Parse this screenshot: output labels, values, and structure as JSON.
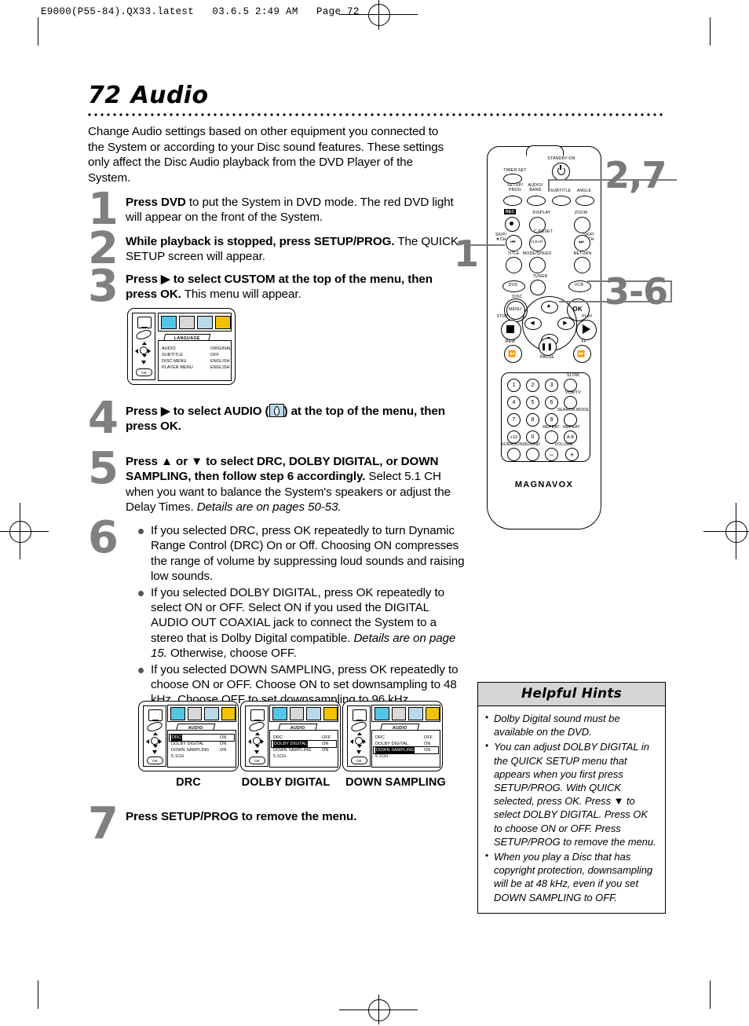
{
  "header": {
    "slug": "E9000(P55-84).QX33.latest   03.6.5 2:49 AM   Page 72"
  },
  "page": {
    "number": "72",
    "title": "Audio",
    "intro": "Change Audio settings based on other equipment you connected to the System or according to your Disc sound features. These settings only affect the Disc Audio playback from the DVD Player of the System."
  },
  "steps": [
    {
      "num": "1",
      "html": "<b>Press DVD</b> to put the System in DVD mode. The red DVD light will appear on the front of the System."
    },
    {
      "num": "2",
      "html": "<b>While playback is stopped, press SETUP/PROG.</b> The QUICK SETUP screen will appear."
    },
    {
      "num": "3",
      "html": "<b>Press ▶ to select CUSTOM at the top of the menu, then press OK.</b>  This menu will appear."
    },
    {
      "num": "4",
      "html": "<b>Press ▶ to select AUDIO (</b><span class=\"inline-audio\" data-name=\"audio-icon\"></span><b>) at the top of the menu, then press OK.</b>"
    },
    {
      "num": "5",
      "html": "<b>Press ▲ or ▼ to select DRC, DOLBY DIGITAL, or DOWN SAMPLING, then follow step 6 accordingly.</b> Select 5.1 CH when you want to balance the System's speakers or adjust the Delay Times. <i>Details are on pages 50-53.</i>"
    },
    {
      "num": "6",
      "bullets": [
        "If you selected DRC, press OK repeatedly to turn Dynamic Range Control (DRC) On or Off. Choosing ON compresses the range of volume by suppressing loud sounds and raising low sounds.",
        "If you selected DOLBY DIGITAL, press OK repeatedly to select ON or OFF. Select ON if you used the DIGITAL AUDIO OUT COAXIAL jack to connect the System to a stereo that is Dolby Digital compatible. <i>Details are on page 15.</i> Otherwise, choose OFF.",
        "If you selected DOWN SAMPLING, press OK repeatedly to choose ON or OFF. Choose ON to set downsampling to 48 kHz. Choose OFF to set downsampling to 96 kHz."
      ]
    },
    {
      "num": "7",
      "html": "<b>Press SETUP/PROG to remove the menu.</b>"
    }
  ],
  "osd_language": {
    "tab": "LANGUAGE",
    "rows": [
      {
        "label": "AUDIO",
        "value": "ORIGINAL",
        "highlight": false
      },
      {
        "label": "SUBTITLE",
        "value": "OFF",
        "highlight": false
      },
      {
        "label": "DISC MENU",
        "value": "ENGLISH",
        "highlight": false
      },
      {
        "label": "PLAYER MENU",
        "value": "ENGLISH",
        "highlight": false
      }
    ],
    "ok_label": "OK"
  },
  "osd_audio_screens": [
    {
      "caption": "DRC",
      "tab": "AUDIO",
      "rows": [
        {
          "label": "DRC",
          "value": "ON",
          "highlight": true
        },
        {
          "label": "DOLBY DIGITAL",
          "value": "ON",
          "highlight": false
        },
        {
          "label": "DOWN SAMPLING",
          "value": "ON",
          "highlight": false
        },
        {
          "label": "5.1CH",
          "value": "",
          "highlight": false
        }
      ],
      "ok_label": "OK"
    },
    {
      "caption": "DOLBY DIGITAL",
      "tab": "AUDIO",
      "rows": [
        {
          "label": "DRC",
          "value": "OFF",
          "highlight": false
        },
        {
          "label": "DOLBY DIGITAL",
          "value": "ON",
          "highlight": true
        },
        {
          "label": "DOWN SAMPLING",
          "value": "ON",
          "highlight": false
        },
        {
          "label": "5.1CH",
          "value": "",
          "highlight": false
        }
      ],
      "ok_label": "OK"
    },
    {
      "caption": "DOWN SAMPLING",
      "tab": "AUDIO",
      "rows": [
        {
          "label": "DRC",
          "value": "OFF",
          "highlight": false
        },
        {
          "label": "DOLBY DIGITAL",
          "value": "ON",
          "highlight": false
        },
        {
          "label": "DOWN SAMPLING",
          "value": "ON",
          "highlight": true
        },
        {
          "label": "5.1CH",
          "value": "",
          "highlight": false
        }
      ],
      "ok_label": "OK"
    }
  ],
  "remote": {
    "brand": "MAGNAVOX",
    "labels": {
      "standby": "STANDBY-ON",
      "timer_set": "TIMER SET",
      "setup_prog": "SETUP/\nPROG",
      "audio_band": "AUDIO/\nBAND",
      "subtitle": "SUBTITLE",
      "angle": "ANGLE",
      "rec": "REC",
      "display": "DISPLAY",
      "zoom": "ZOOM",
      "c_reset": "C-RESET",
      "clear": "CLEAR",
      "skip_down": "SKIP/\n▼CH",
      "skip_up": "SKIP/\n▲CH",
      "title": "TITLE",
      "mode_speed": "MODE/SPEED",
      "return": "RETURN",
      "tuner": "TUNER",
      "dvd": "DVD",
      "vcr": "VCR",
      "disc": "DISC",
      "menu": "MENU",
      "ok": "OK",
      "stop": "STOP",
      "play": "PLAY",
      "rew": "REW",
      "ff": "FF",
      "pause": "PAUSE",
      "slow": "SLOW",
      "vcr_tv": "VCR/TV",
      "search_mode": "SEARCH MODE",
      "repeat": "REPEAT",
      "repeat_ab": "REPEAT",
      "repeat_ab_btn": "A-B",
      "surround": "SURROUND",
      "sound": "SOUND",
      "volume": "VOLUME",
      "plus10": "+10"
    },
    "keys": [
      "1",
      "2",
      "3",
      "4",
      "5",
      "6",
      "7",
      "8",
      "9",
      "+10",
      "0"
    ]
  },
  "callouts": {
    "setup": "2,7",
    "dvd": "1",
    "ok": "3-6"
  },
  "hints": {
    "heading": "Helpful Hints",
    "items": [
      "Dolby Digital sound must be available on the DVD.",
      "You can adjust DOLBY DIGITAL in the QUICK SETUP menu that appears when you first press SETUP/PROG. With QUICK selected, press OK. Press ▼ to select DOLBY DIGITAL. Press OK to choose ON or OFF. Press SETUP/PROG to remove the menu.",
      "When you play a Disc that has copyright protection, downsampling will be at 48 kHz, even if you set DOWN SAMPLING to OFF."
    ]
  }
}
